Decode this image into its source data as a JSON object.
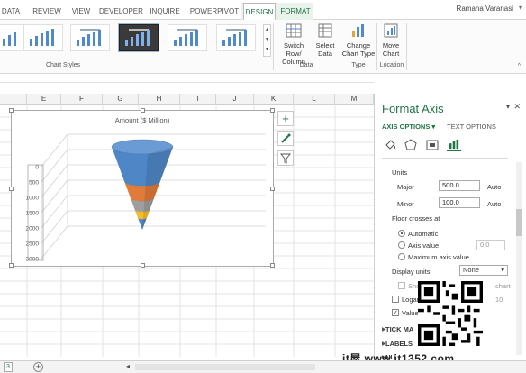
{
  "ribbon": {
    "tabs": [
      "DATA",
      "REVIEW",
      "VIEW",
      "DEVELOPER",
      "INQUIRE",
      "POWERPIVOT",
      "DESIGN",
      "FORMAT"
    ],
    "active_tab": "DESIGN",
    "user": "Ramana Varanasi",
    "groups": {
      "chart_styles": "Chart Styles",
      "data": "Data",
      "type": "Type",
      "location": "Location"
    },
    "buttons": {
      "switch_row_col": "Switch Row/ Column",
      "select_data": "Select Data",
      "change_chart_type": "Change Chart Type",
      "move_chart": "Move Chart"
    }
  },
  "grid": {
    "columns": [
      "E",
      "F",
      "G",
      "H",
      "I",
      "J",
      "K",
      "L",
      "M"
    ]
  },
  "chart_data": {
    "type": "3d-cone",
    "title": "Amount ($ Million)",
    "y_ticks": [
      "0",
      "500",
      "1000",
      "1500",
      "2000",
      "2500",
      "3000"
    ],
    "reversed_axis": true,
    "ylim": [
      0,
      3000
    ],
    "series_colors": [
      "#4e86c6",
      "#e07b39",
      "#9e9e9e",
      "#f2bd2a",
      "#4e86c6"
    ]
  },
  "format_pane": {
    "title": "Format Axis",
    "tabs": {
      "axis_options": "AXIS OPTIONS",
      "text_options": "TEXT OPTIONS"
    },
    "units_heading": "Units",
    "major_label": "Major",
    "major_value": "500.0",
    "major_mode": "Auto",
    "minor_label": "Minor",
    "minor_value": "100.0",
    "minor_mode": "Auto",
    "floor_crosses_at": "Floor crosses at",
    "opt_automatic": "Automatic",
    "opt_axis_value": "Axis value",
    "axis_value_field": "0.0",
    "opt_max_axis_value": "Maximum axis value",
    "display_units_label": "Display units",
    "display_units_value": "None",
    "show_units_label": "Sho",
    "show_units_tail": "chart",
    "log_scale_label": "Logar",
    "log_base": "10",
    "values_reverse_label": "Value",
    "sections": [
      "TICK MA",
      "LABELS",
      "NU"
    ]
  },
  "icons": {
    "add_element": "plus-icon",
    "brush": "brush-icon",
    "filter": "filter-icon"
  },
  "watermark": "it屋 www.it1352.com"
}
